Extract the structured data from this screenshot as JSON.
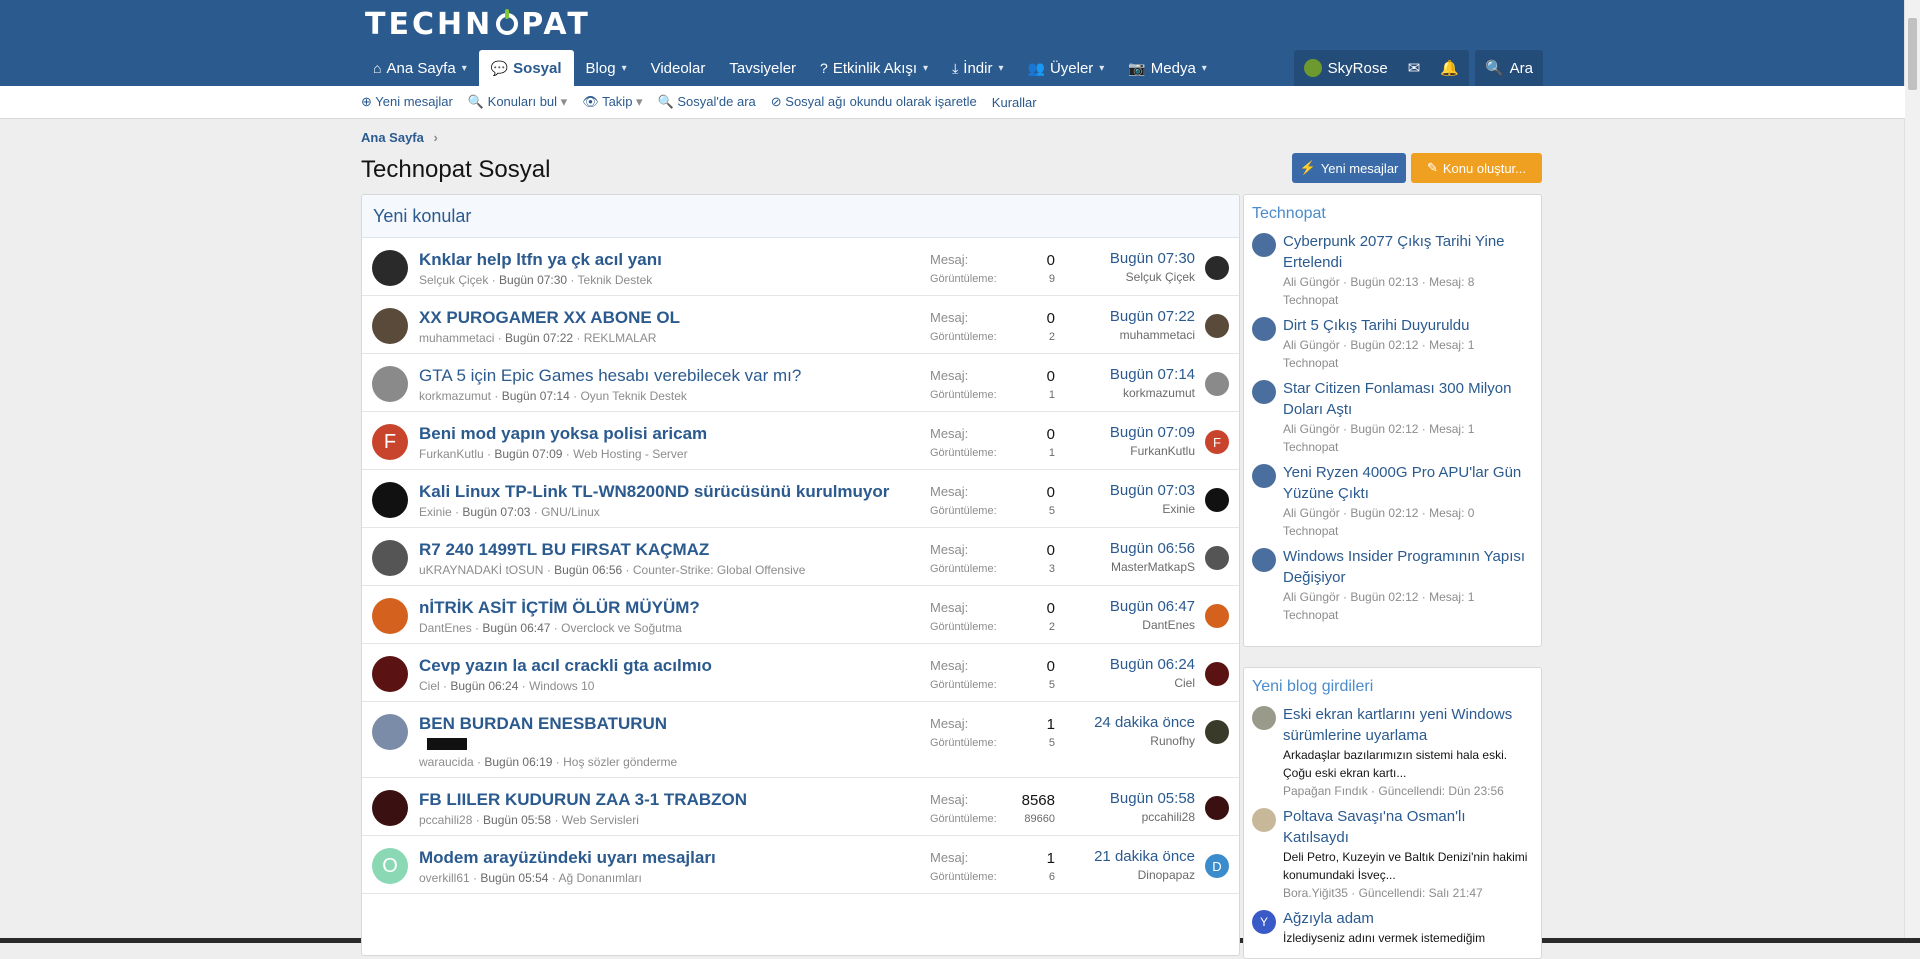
{
  "header": {
    "logo_text": "TECHNOPAT",
    "nav": [
      {
        "label": "Ana Sayfa",
        "icon": "home-icon"
      },
      {
        "label": "Sosyal",
        "icon": "comments-icon"
      },
      {
        "label": "Blog",
        "icon": ""
      },
      {
        "label": "Videolar",
        "icon": ""
      },
      {
        "label": "Tavsiyeler",
        "icon": ""
      },
      {
        "label": "Etkinlik Akışı",
        "icon": "bolt-icon"
      },
      {
        "label": "İndir",
        "icon": "download-icon"
      },
      {
        "label": "Üyeler",
        "icon": "users-icon"
      },
      {
        "label": "Medya",
        "icon": "camera-icon"
      }
    ],
    "user": "SkyRose",
    "search": "Ara"
  },
  "subnav": [
    "Yeni mesajlar",
    "Konuları bul",
    "Takip",
    "Sosyal'de ara",
    "Sosyal ağı okundu olarak işaretle",
    "Kurallar"
  ],
  "breadcrumb": "Ana Sayfa",
  "page_title": "Technopat Sosyal",
  "buttons": {
    "new_posts": "Yeni mesajlar",
    "create_thread": "Konu oluştur..."
  },
  "main": {
    "heading": "Yeni konular",
    "stat_labels": {
      "messages": "Mesaj:",
      "views": "Görüntüleme:"
    },
    "threads": [
      {
        "title": "Knklar help ltfn ya çk acıl yanı",
        "bold": true,
        "author": "Selçuk Çiçek",
        "time": "Bugün 07:30",
        "forum": "Teknik Destek",
        "replies": "0",
        "views": "9",
        "last_time": "Bugün 07:30",
        "last_user": "Selçuk Çiçek",
        "avatar_color": "#2a2a2a",
        "avatar_letter": "",
        "mini_color": "#2a2a2a",
        "mini_letter": ""
      },
      {
        "title": "XX PUROGAMER XX ABONE OL",
        "bold": true,
        "author": "muhammetaci",
        "time": "Bugün 07:22",
        "forum": "REKLMALAR",
        "replies": "0",
        "views": "2",
        "last_time": "Bugün 07:22",
        "last_user": "muhammetaci",
        "avatar_color": "#5a4a3a",
        "avatar_letter": "",
        "mini_color": "#5a4a3a",
        "mini_letter": ""
      },
      {
        "title": "GTA 5 için Epic Games hesabı verebilecek var mı?",
        "bold": false,
        "author": "korkmazumut",
        "time": "Bugün 07:14",
        "forum": "Oyun Teknik Destek",
        "replies": "0",
        "views": "1",
        "last_time": "Bugün 07:14",
        "last_user": "korkmazumut",
        "avatar_color": "#8a8a8a",
        "avatar_letter": "",
        "mini_color": "#8a8a8a",
        "mini_letter": ""
      },
      {
        "title": "Beni mod yapın yoksa polisi aricam",
        "bold": true,
        "author": "FurkanKutlu",
        "time": "Bugün 07:09",
        "forum": "Web Hosting - Server",
        "replies": "0",
        "views": "1",
        "last_time": "Bugün 07:09",
        "last_user": "FurkanKutlu",
        "avatar_color": "#c9442c",
        "avatar_letter": "F",
        "mini_color": "#c9442c",
        "mini_letter": "F"
      },
      {
        "title": "Kali Linux TP-Link TL-WN8200ND sürücüsünü kurulmuyor",
        "bold": true,
        "author": "Exinie",
        "time": "Bugün 07:03",
        "forum": "GNU/Linux",
        "replies": "0",
        "views": "5",
        "last_time": "Bugün 07:03",
        "last_user": "Exinie",
        "avatar_color": "#111111",
        "avatar_letter": "",
        "mini_color": "#111111",
        "mini_letter": ""
      },
      {
        "title": "R7 240 1499TL BU FIRSAT KAÇMAZ",
        "bold": true,
        "author": "uKRAYNADAKİ tOSUN",
        "time": "Bugün 06:56",
        "forum": "Counter-Strike: Global Offensive",
        "replies": "0",
        "views": "3",
        "last_time": "Bugün 06:56",
        "last_user": "MasterMatkapS",
        "avatar_color": "#555555",
        "avatar_letter": "",
        "mini_color": "#555555",
        "mini_letter": ""
      },
      {
        "title": "nİTRİK ASİT İÇTİM ÖLÜR MÜYÜM?",
        "bold": true,
        "author": "DantEnes",
        "time": "Bugün 06:47",
        "forum": "Overclock ve Soğutma",
        "replies": "0",
        "views": "2",
        "last_time": "Bugün 06:47",
        "last_user": "DantEnes",
        "avatar_color": "#d4621e",
        "avatar_letter": "",
        "mini_color": "#d4621e",
        "mini_letter": ""
      },
      {
        "title": "Cevp yazın la acıl crackli gta acılmıo",
        "bold": true,
        "author": "Ciel",
        "time": "Bugün 06:24",
        "forum": "Windows 10",
        "replies": "0",
        "views": "5",
        "last_time": "Bugün 06:24",
        "last_user": "Ciel",
        "avatar_color": "#5a1212",
        "avatar_letter": "",
        "mini_color": "#5a1212",
        "mini_letter": ""
      },
      {
        "title": "BEN BURDAN ENESBATURUN",
        "bold": true,
        "author": "waraucida",
        "time": "Bugün 06:19",
        "forum": "Hoş sözler gönderme",
        "replies": "1",
        "views": "5",
        "last_time": "24 dakika önce",
        "last_user": "Runofhy",
        "avatar_color": "#7a8ca8",
        "avatar_letter": "",
        "mini_color": "#3a3a2a",
        "mini_letter": ""
      },
      {
        "title": "FB LIILER KUDURUN ZAA 3-1 TRABZON",
        "bold": true,
        "author": "pccahili28",
        "time": "Bugün 05:58",
        "forum": "Web Servisleri",
        "replies": "8568",
        "views": "89660",
        "last_time": "Bugün 05:58",
        "last_user": "pccahili28",
        "avatar_color": "#3a1010",
        "avatar_letter": "",
        "mini_color": "#3a1010",
        "mini_letter": ""
      },
      {
        "title": "Modem arayüzündeki uyarı mesajları",
        "bold": true,
        "author": "overkill61",
        "time": "Bugün 05:54",
        "forum": "Ağ Donanımları",
        "replies": "1",
        "views": "6",
        "last_time": "21 dakika önce",
        "last_user": "Dinopapaz",
        "avatar_color": "#8ad8b4",
        "avatar_letter": "O",
        "mini_color": "#3a8ccc",
        "mini_letter": "D"
      }
    ]
  },
  "sidebar": {
    "news_heading": "Technopat",
    "news": [
      {
        "title": "Cyberpunk 2077 Çıkış Tarihi Yine Ertelendi",
        "meta": "Ali Güngör · Bugün 02:13 · Mesaj: 8",
        "forum": "Technopat"
      },
      {
        "title": "Dirt 5 Çıkış Tarihi Duyuruldu",
        "meta": "Ali Güngör · Bugün 02:12 · Mesaj: 1",
        "forum": "Technopat"
      },
      {
        "title": "Star Citizen Fonlaması 300 Milyon Doları Aştı",
        "meta": "Ali Güngör · Bugün 02:12 · Mesaj: 1",
        "forum": "Technopat"
      },
      {
        "title": "Yeni Ryzen 4000G Pro APU'lar Gün Yüzüne Çıktı",
        "meta": "Ali Güngör · Bugün 02:12 · Mesaj: 0",
        "forum": "Technopat"
      },
      {
        "title": "Windows Insider Programının Yapısı Değişiyor",
        "meta": "Ali Güngör · Bugün 02:12 · Mesaj: 1",
        "forum": "Technopat"
      }
    ],
    "blog_heading": "Yeni blog girdileri",
    "blogs": [
      {
        "title": "Eski ekran kartlarını yeni Windows sürümlerine uyarlama",
        "snippet": "Arkadaşlar bazılarımızın sistemi hala eski. Çoğu eski ekran kartı...",
        "meta": "Papağan Fındık · Güncellendi: Dün 23:56",
        "avatar_color": "#9a9a8a",
        "avatar_letter": ""
      },
      {
        "title": "Poltava Savaşı'na Osman'lı Katılsaydı",
        "snippet": "Deli Petro, Kuzeyin ve Baltık Denizi'nin hakimi konumundaki İsveç...",
        "meta": "Bora.Yiğit35 · Güncellendi: Salı 21:47",
        "avatar_color": "#c8b89a",
        "avatar_letter": ""
      },
      {
        "title": "Ağzıyla adam",
        "snippet": "İzlediyseniz adını vermek istemediğim",
        "meta": "",
        "avatar_color": "#3a5ac8",
        "avatar_letter": "Y"
      }
    ]
  }
}
